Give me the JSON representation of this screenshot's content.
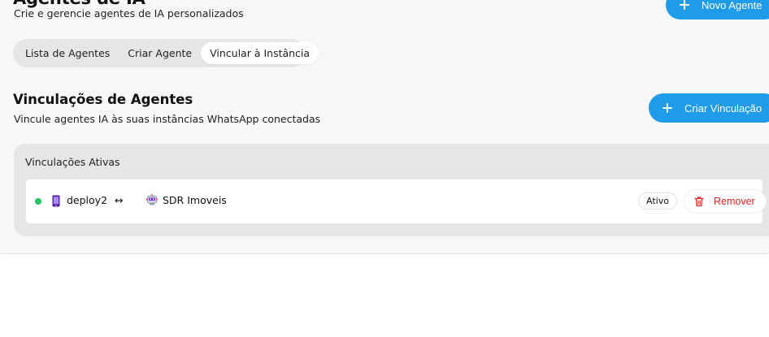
{
  "header": {
    "title": "Agentes de IA",
    "subtitle": "Crie e gerencie agentes de IA personalizados",
    "new_agent_label": "Novo Agente"
  },
  "tabs": [
    {
      "label": "Lista de Agentes",
      "active": false
    },
    {
      "label": "Criar Agente",
      "active": false
    },
    {
      "label": "Vincular à Instância",
      "active": true
    }
  ],
  "section": {
    "title": "Vinculações de Agentes",
    "subtitle": "Vincule agentes IA às suas instâncias WhatsApp conectadas",
    "create_label": "Criar Vinculação"
  },
  "active_links": {
    "title": "Vinculações Ativas",
    "items": [
      {
        "instance": "deploy2",
        "instance_icon": "phone-icon",
        "link_symbol": "↔",
        "agent": "SDR Imoveis",
        "agent_icon": "robot-icon",
        "status": "Ativo",
        "status_color": "#22c55e",
        "remove_label": "Remover"
      }
    ]
  },
  "colors": {
    "accent": "#1e9be9",
    "danger": "#dc2626",
    "online": "#22c55e"
  }
}
